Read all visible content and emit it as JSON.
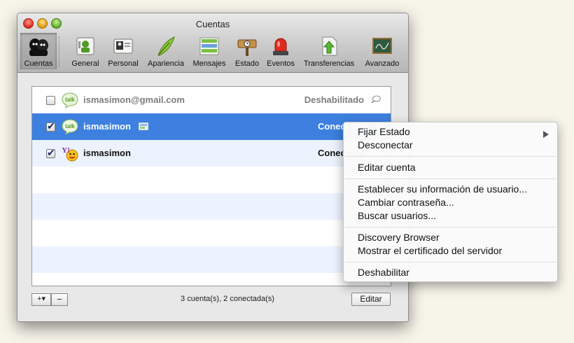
{
  "window": {
    "title": "Cuentas"
  },
  "toolbar": [
    {
      "id": "cuentas",
      "label": "Cuentas",
      "icon": "accounts-icon",
      "selected": true
    },
    {
      "id": "general",
      "label": "General",
      "icon": "general-icon"
    },
    {
      "id": "personal",
      "label": "Personal",
      "icon": "personal-icon"
    },
    {
      "id": "apariencia",
      "label": "Apariencia",
      "icon": "appearance-icon"
    },
    {
      "id": "mensajes",
      "label": "Mensajes",
      "icon": "messages-icon"
    },
    {
      "id": "estado",
      "label": "Estado",
      "icon": "status-sign-icon"
    },
    {
      "id": "eventos",
      "label": "Eventos",
      "icon": "siren-icon"
    },
    {
      "id": "transferencias",
      "label": "Transferencias",
      "icon": "transfer-icon"
    },
    {
      "id": "avanzado",
      "label": "Avanzado",
      "icon": "chalkboard-icon"
    }
  ],
  "accounts": [
    {
      "name": "ismasimon@gmail.com",
      "service": "gtalk-icon",
      "checked": false,
      "status": "Deshabilitado",
      "selected": false,
      "status_icon": "speech-bubble-icon"
    },
    {
      "name": "ismasimon",
      "service": "gtalk-icon",
      "checked": true,
      "status": "Conectado",
      "selected": true,
      "status_icon": "card-icon"
    },
    {
      "name": "ismasimon",
      "service": "yahoo-icon",
      "checked": true,
      "status": "Conectado",
      "selected": false
    }
  ],
  "footer": {
    "add_label": "+▾",
    "remove_label": "−",
    "summary": "3 cuenta(s), 2 conectada(s)",
    "edit_label": "Editar"
  },
  "context_menu": {
    "fijar_estado": "Fijar Estado",
    "desconectar": "Desconectar",
    "editar_cuenta": "Editar cuenta",
    "establecer_info": "Establecer su información de usuario...",
    "cambiar_contrasena": "Cambiar contraseña...",
    "buscar_usuarios": "Buscar usuarios...",
    "discovery_browser": "Discovery Browser",
    "mostrar_certificado": "Mostrar el certificado del servidor",
    "deshabilitar": "Deshabilitar"
  },
  "colors": {
    "selection": "#3d80df",
    "stripe": "#edf3fe",
    "gtalk_green": "#6bb82e",
    "yahoo_purple": "#7b2a9e"
  }
}
